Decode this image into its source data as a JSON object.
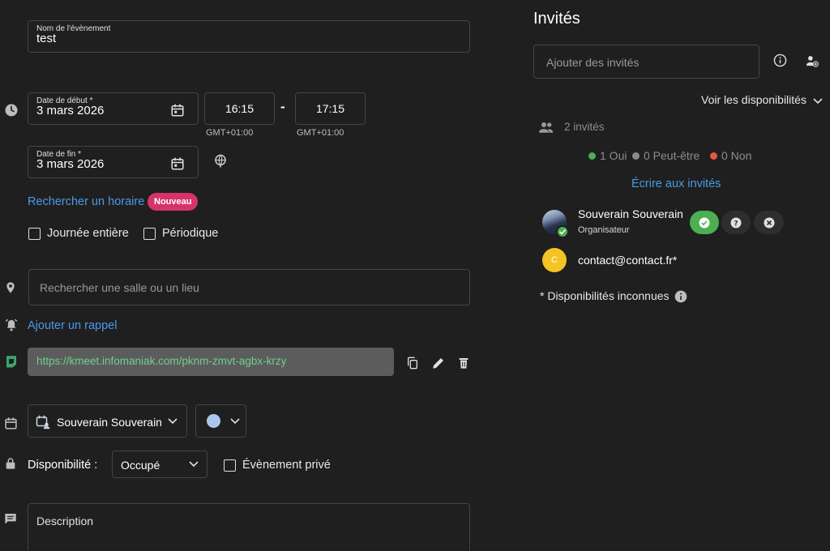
{
  "event": {
    "name_label": "Nom de l'évènement",
    "name_value": "test",
    "start_label": "Date de début *",
    "start_date": "3 mars 2026",
    "start_time": "16:15",
    "separator": "-",
    "end_time": "17:15",
    "tz_start": "GMT+01:00",
    "tz_end": "GMT+01:00",
    "end_label": "Date de fin *",
    "end_date": "3 mars 2026",
    "search_schedule": "Rechercher un horaire",
    "new_badge": "Nouveau",
    "all_day": "Journée entière",
    "recurring": "Périodique",
    "location_placeholder": "Rechercher une salle ou un lieu",
    "add_reminder": "Ajouter un rappel",
    "meet_link": "https://kmeet.infomaniak.com/pknm-zmvt-agbx-krzy",
    "calendar_name": "Souverain Souverain",
    "calendar_color": "#a9c7ea",
    "availability_label": "Disponibilité :",
    "availability_value": "Occupé",
    "private": "Évènement privé",
    "description_placeholder": "Description"
  },
  "guests": {
    "title": "Invités",
    "add_placeholder": "Ajouter des invités",
    "see_availability": "Voir les disponibilités",
    "count": "2 invités",
    "yes": "1 Oui",
    "maybe": "0 Peut-être",
    "no": "0 Non",
    "yes_color": "#4caf50",
    "maybe_color": "#8a8a8a",
    "no_color": "#e8563f",
    "write_to_guests": "Écrire aux invités",
    "list": [
      {
        "name": "Souverain Souverain",
        "role": "Organisateur"
      },
      {
        "name": "contact@contact.fr*",
        "initial": "C"
      }
    ],
    "unknown_availability": "* Disponibilités inconnues"
  }
}
